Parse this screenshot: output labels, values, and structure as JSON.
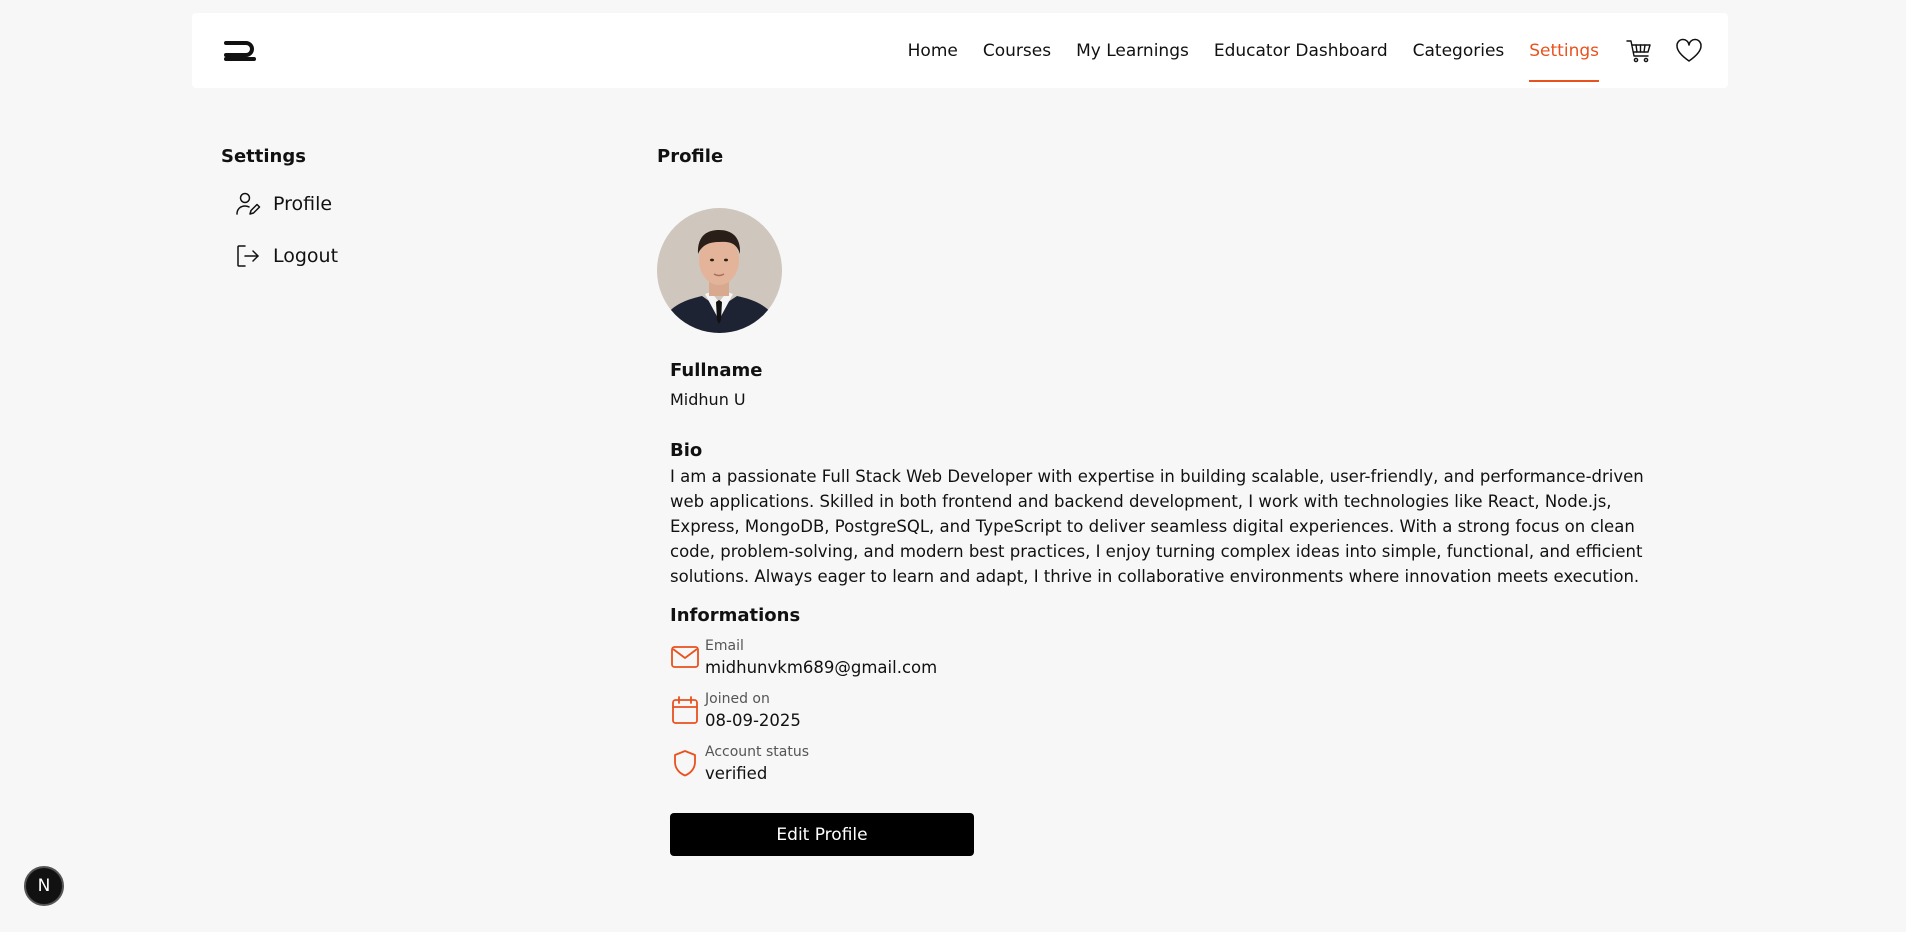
{
  "nav": {
    "items": [
      {
        "label": "Home",
        "name": "nav-home"
      },
      {
        "label": "Courses",
        "name": "nav-courses"
      },
      {
        "label": "My Learnings",
        "name": "nav-my-learnings"
      },
      {
        "label": "Educator Dashboard",
        "name": "nav-educator-dashboard"
      },
      {
        "label": "Categories",
        "name": "nav-categories"
      },
      {
        "label": "Settings",
        "name": "nav-settings",
        "active": true
      }
    ],
    "icons": [
      "cart-icon",
      "heart-icon"
    ]
  },
  "sidebar": {
    "title": "Settings",
    "items": [
      {
        "label": "Profile",
        "icon": "user-edit-icon"
      },
      {
        "label": "Logout",
        "icon": "logout-icon"
      }
    ]
  },
  "profile": {
    "title": "Profile",
    "fullname_label": "Fullname",
    "fullname": "Midhun U",
    "bio_label": "Bio",
    "bio": "I am a passionate Full Stack Web Developer with expertise in building scalable, user-friendly, and performance-driven web applications. Skilled in both frontend and backend development, I work with technologies like React, Node.js, Express, MongoDB, PostgreSQL, and TypeScript to deliver seamless digital experiences. With a strong focus on clean code, problem-solving, and modern best practices, I enjoy turning complex ideas into simple, functional, and efficient solutions. Always eager to learn and adapt, I thrive in collaborative environments where innovation meets execution.",
    "info_title": "Informations",
    "info": [
      {
        "label": "Email",
        "value": "midhunvkm689@gmail.com",
        "icon": "mail-icon"
      },
      {
        "label": "Joined on",
        "value": "08-09-2025",
        "icon": "calendar-icon"
      },
      {
        "label": "Account status",
        "value": "verified",
        "icon": "shield-icon"
      }
    ],
    "edit_button": "Edit Profile"
  },
  "badge": {
    "letter": "N"
  },
  "colors": {
    "accent": "#e8521f",
    "background": "#f7f7f7",
    "button": "#000000"
  }
}
